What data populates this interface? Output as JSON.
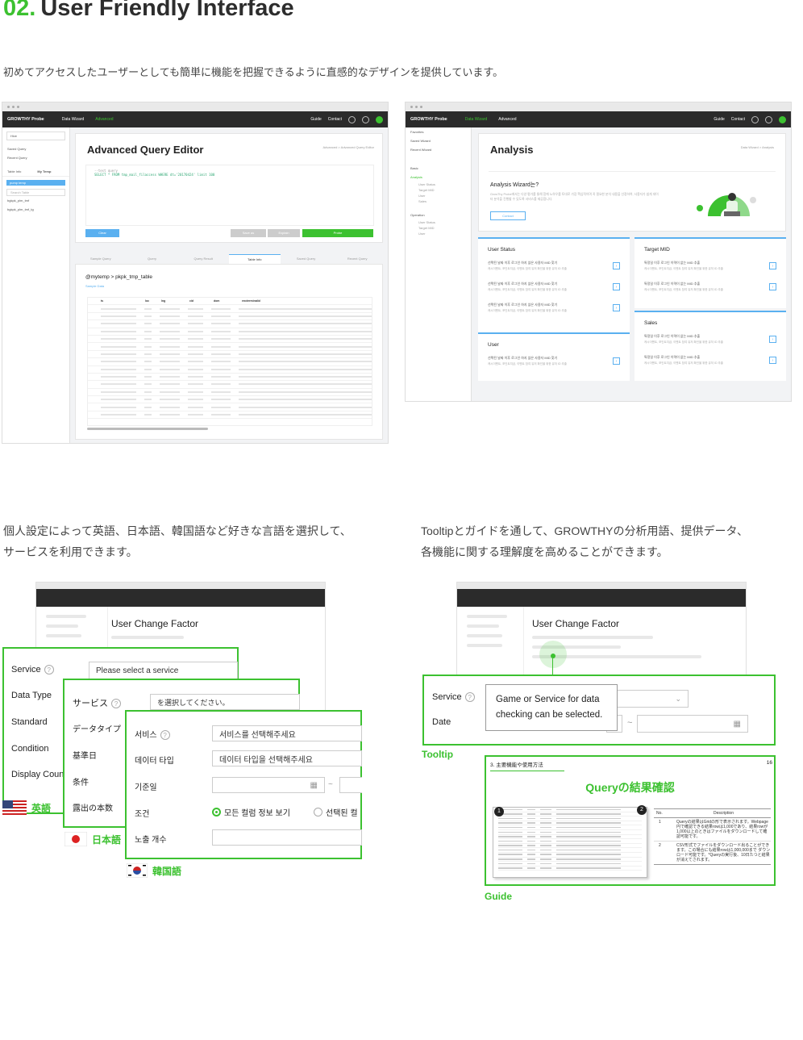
{
  "header": {
    "num": "02.",
    "title": "User Friendly Interface"
  },
  "intro": "初めてアクセスしたユーザーとしても簡単に機能を把握できるように直感的なデザインを提供しています。",
  "caption_left": [
    "個人設定によって英語、日本語、韓国語など好きな言語を選択して、",
    "サービスを利用できます。"
  ],
  "caption_right": [
    "Tooltipとガイドを通して、GROWTHYの分析用語、提供データ、",
    "各機能に関する理解度を高めることができます。"
  ],
  "app": {
    "logo": "GROWTHY Probe",
    "nav_data": "Data Wizard",
    "nav_adv": "Advanced",
    "guide": "Guide",
    "contact": "Contact"
  },
  "query": {
    "title": "Advanced Query Editor",
    "crumb": "Advanced  >  Advanced Query Editor",
    "side": [
      "Hive",
      "Saved Query",
      "Recent Query",
      "Table Info",
      "My Temp",
      "pump temp",
      "Search Table",
      "bgkpk_plm_tmf",
      "bgkpk_plm_tmf_tg"
    ],
    "code1": "--test query",
    "code2": "SELECT * FROM tmp_mail_filaccess WHERE dt='20170424' limit 100",
    "btn_clear": "Clear",
    "btn_save": "Save as",
    "btn_explain": "Explain",
    "btn_probe": "Probe",
    "tabs": [
      "Sample Query",
      "Query",
      "Query Result",
      "Table Info",
      "Saved Query",
      "Recent Query"
    ],
    "table_path": "@mytemp  >  pkpk_tmp_table",
    "sample": "Sample Data",
    "cols": [
      "ts",
      "loc",
      "lng",
      "cid",
      "dom",
      "encterminalid"
    ]
  },
  "analysis": {
    "title": "Analysis",
    "crumb": "Data Wizard  >  Analysis",
    "side": [
      "Favorites",
      "Saved Wizard",
      "Recent Wizard",
      "Basic",
      "Analysis",
      "User Status",
      "Target MID",
      "User",
      "Sales",
      "Operation",
      "User Status",
      "Target MID",
      "User"
    ],
    "wizard_title": "Analysis Wizard는?",
    "wizard_desc": "GrowThy Probe에서는 다양 평가를 통해 함께 노하우를 토대로 가장 핵심적이며 꼭 필요한 분석 내용을 선정하여, 사용자가 쉽게 데이터 분석을 진행할 수 있도록 서비스를 제공합니다.",
    "contact": "Contact",
    "cards": {
      "user_status": "User Status",
      "target_mid": "Target MID",
      "user": "User",
      "sales": "Sales",
      "item_a": "선택된 날짜 이후 로그인 하지 않은 사용자 MID 찾기",
      "item_b": "특정일 이후 로그인 이력이 없는 MID 추출",
      "sub": "캐시이벤트, 포인트지급, 이벤트 참여 유저 확인을 위한 유저 ID 추출"
    }
  },
  "lang": {
    "win_title": "User Change Factor",
    "en": {
      "service": "Service",
      "datatype": "Data Type",
      "standard": "Standard",
      "condition": "Condition",
      "display": "Display Coun",
      "placeholder": "Please select a service",
      "flag": "英語"
    },
    "ja": {
      "service": "サービス",
      "datatype": "データタイプ",
      "standard": "基準日",
      "condition": "条件",
      "display": "露出の本数",
      "placeholder": "を選択してください。",
      "flag": "日本語"
    },
    "ko": {
      "service": "서비스",
      "datatype": "데이터 타입",
      "standard": "기준일",
      "condition": "조건",
      "display": "노출 개수",
      "placeholder": "서비스를 선택해주세요",
      "placeholder2": "데이터 타입을 선택해주세요",
      "radio1": "모든 컬럼 정보 보기",
      "radio2": "선택된 컬",
      "flag": "韓国語",
      "tilde": "~"
    }
  },
  "tooltip": {
    "win_title": "User Change Factor",
    "service": "Service",
    "date": "Date",
    "text": "Game or Service for data checking can be selected.",
    "tilde": "~",
    "label": "Tooltip"
  },
  "guide": {
    "section": "3. 主要機能や使用方法",
    "page": "16",
    "title": "Queryの結果確認",
    "th_no": "No.",
    "th_desc": "Description",
    "rows": [
      {
        "no": "1",
        "desc": "Queryの結果はGridの形で表示されます。Webpage円で確認できる結果rowは1,000であり、結果rowが1,000以上のときはファイルをダウンロードして確認可能です。"
      },
      {
        "no": "2",
        "desc": "CSV形式でファイルをダウンロード出ることができます。この場合にも結果rowは1,000,000まで ダウンロード可能です。*Queryの実行後、10日たつと結果が消えてされます。"
      }
    ],
    "badge1": "1",
    "badge2": "2",
    "label": "Guide"
  },
  "colors": {
    "green": "#3cc130",
    "blue": "#5ab0f0",
    "dark": "#2b2b2b"
  }
}
